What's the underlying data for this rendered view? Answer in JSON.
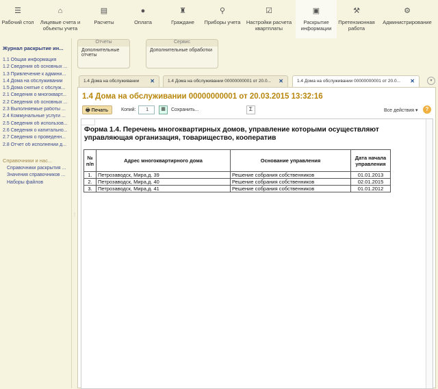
{
  "nav": [
    {
      "label": "Рабочий стол",
      "icon": "menu-icon"
    },
    {
      "label": "Лицевые счета и объекты учета",
      "icon": "house-icon"
    },
    {
      "label": "Расчеты",
      "icon": "calculator-icon"
    },
    {
      "label": "Оплата",
      "icon": "coins-icon"
    },
    {
      "label": "Граждане",
      "icon": "people-icon"
    },
    {
      "label": "Приборы учета",
      "icon": "meter-icon"
    },
    {
      "label": "Настройки расчета квартплаты",
      "icon": "checkbox-icon"
    },
    {
      "label": "Раскрытие информации",
      "icon": "document-icon",
      "active": true
    },
    {
      "label": "Претензионная работа",
      "icon": "gavel-icon"
    },
    {
      "label": "Администрирование",
      "icon": "gear-icon"
    }
  ],
  "sidebar": {
    "title": "Журнал раскрытие ин...",
    "items": [
      "1.1 Общая информация",
      "1.2 Сведения об основных ...",
      "1.3 Привлечение к админи...",
      "1.4 Дома на обслуживании",
      "1.5 Дома снятые с обслуж...",
      "2.1 Сведения о многокварт...",
      "2.2 Сведения об основных ...",
      "2.3 Выполняемые работы ...",
      "2.4 Коммунальные услуги ...",
      "2.5 Сведения об использов...",
      "2.6 Сведения о капитально...",
      "2.7 Сведения о проведенн...",
      "2.8 Отчет об исполнении д..."
    ],
    "section": "Справочники и нас...",
    "subitems": [
      "Справочники раскрытия ...",
      "Значения справочников ...",
      "Наборы файлов"
    ]
  },
  "groups": [
    {
      "header": "Отчеты",
      "item": "Дополнительные отчеты"
    },
    {
      "header": "Сервис",
      "item": "Дополнительные обработки"
    }
  ],
  "tabs": [
    "1.4 Дома на обслуживании",
    "1.4 Дома на обслуживании 00000000001 от 20.0...",
    "1.4 Дома на обслуживании 00000000001 от 20.0..."
  ],
  "title": "1.4 Дома на обслуживании 00000000001 от 20.03.2015 13:32:16",
  "toolbar": {
    "print": "Печать",
    "copies_label": "Копий:",
    "copies": "1",
    "save": "Сохранить...",
    "sum": "Σ",
    "all_actions": "Все действия ▾",
    "help": "?"
  },
  "form": {
    "title": "Форма 1.4. Перечень многоквартирных домов, управление которыми осуществляют управляющая организация, товарищество, кооператив",
    "headers": [
      "№ п/п",
      "Адрес многоквартирного дома",
      "Основание управления",
      "Дата начала управления"
    ],
    "rows": [
      [
        "1.",
        "Петрозаводск, Мира,д. 39",
        "Решение собрания собственников",
        "01.01.2013"
      ],
      [
        "2.",
        "Петрозаводск, Мира,д. 40",
        "Решение собрания собственников",
        "02.01.2015"
      ],
      [
        "3.",
        "Петрозаводск, Мира,д. 41",
        "Решение собрания собственников",
        "01.01.2012"
      ]
    ]
  },
  "colors": {
    "title": "#b8860b",
    "link": "#3a4a90"
  }
}
